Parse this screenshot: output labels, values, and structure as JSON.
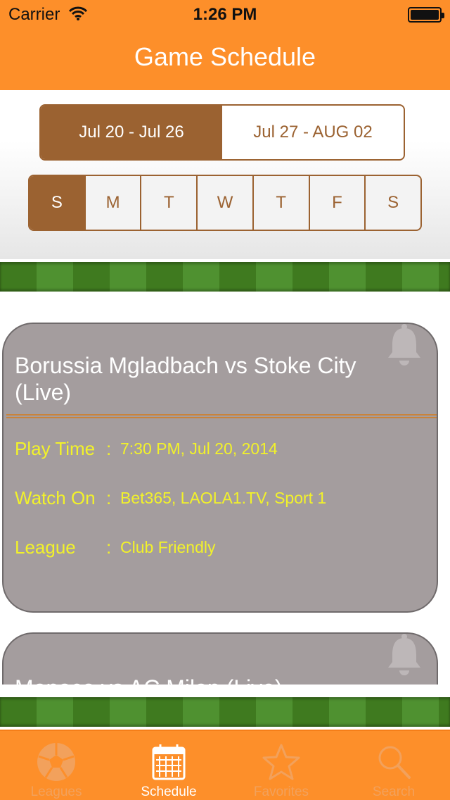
{
  "status_bar": {
    "carrier": "Carrier",
    "time": "1:26 PM"
  },
  "header": {
    "title": "Game Schedule"
  },
  "week_selector": {
    "options": [
      "Jul 20 - Jul 26",
      "Jul 27 - AUG 02"
    ],
    "selected_index": 0
  },
  "day_selector": {
    "days": [
      "S",
      "M",
      "T",
      "W",
      "T",
      "F",
      "S"
    ],
    "selected_index": 0
  },
  "matches": [
    {
      "title": "Borussia Mgladbach vs Stoke City (Live)",
      "play_time_label": "Play Time",
      "play_time": "7:30 PM, Jul 20, 2014",
      "watch_on_label": "Watch On",
      "watch_on": "Bet365, LAOLA1.TV, Sport 1",
      "league_label": "League",
      "league": "Club Friendly"
    },
    {
      "title": "Monaco vs AC Milan (Live)"
    }
  ],
  "colon": ":",
  "tab_bar": {
    "tabs": [
      {
        "label": "Leagues",
        "icon": "soccer-ball-icon"
      },
      {
        "label": "Schedule",
        "icon": "calendar-icon"
      },
      {
        "label": "Favorites",
        "icon": "star-icon"
      },
      {
        "label": "Search",
        "icon": "search-icon"
      }
    ],
    "selected_index": 1
  },
  "colors": {
    "accent_orange": "#fd8f2a",
    "segment_brown": "#9b6231",
    "card_gray": "#a49d9e",
    "info_yellow": "#f2f22a"
  }
}
